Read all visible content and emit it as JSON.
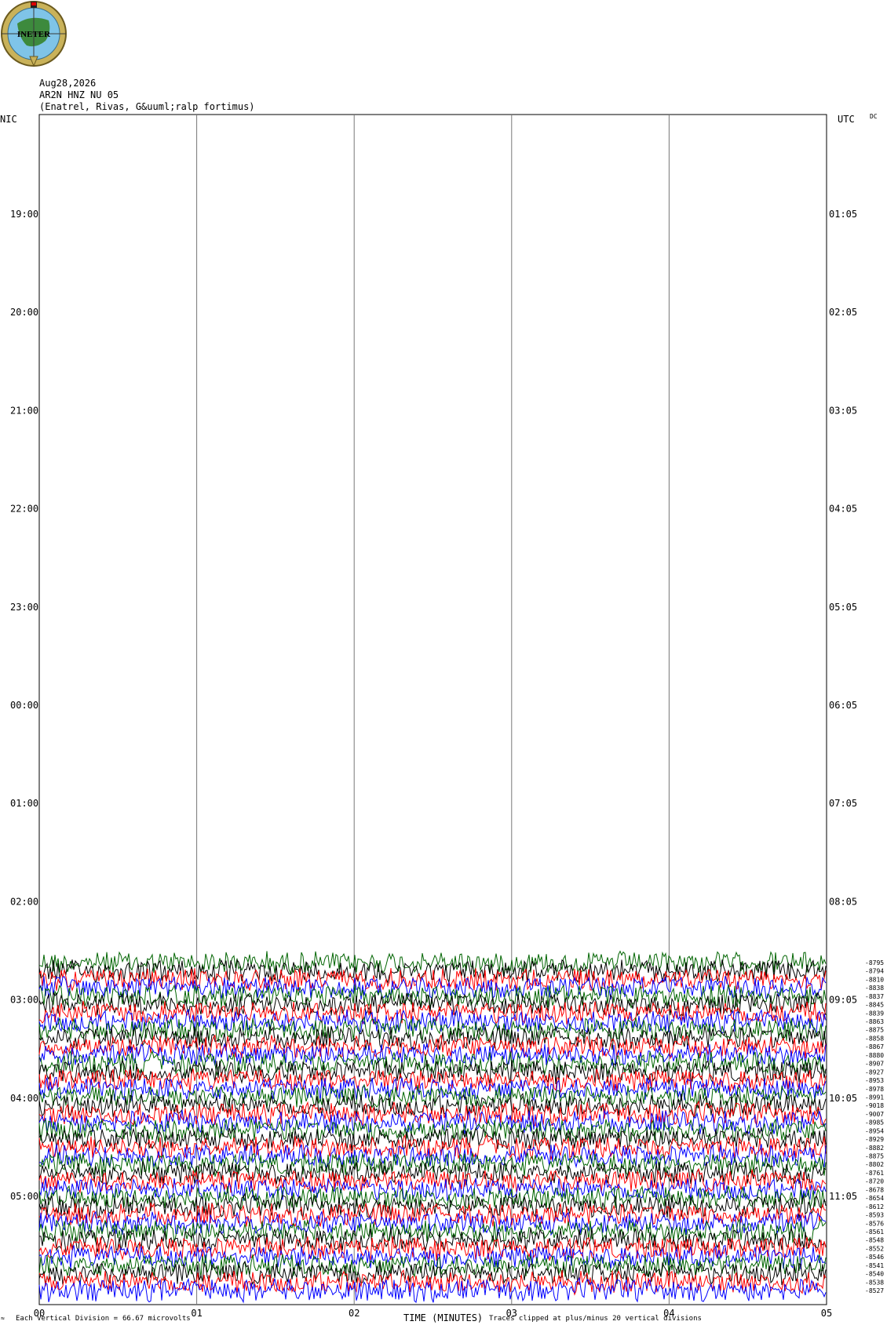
{
  "header": {
    "date": "Aug28,2026",
    "station": "AR2N HNZ NU 05",
    "location": "(Enatrel, Rivas, G&uuml;ralp fortimus)"
  },
  "logo": {
    "text": "INETER",
    "icon": "ineter-globe-logo"
  },
  "axis_corners": {
    "left": "NIC",
    "right": "UTC",
    "right_small": "DC"
  },
  "footer": {
    "left_mark": "≈",
    "vertical_division": "Each Vertical Division =",
    "vertical_value": "66.67 microvolts",
    "xlabel": "TIME (MINUTES)",
    "clip_note": "Traces clipped at plus/minus 20 vertical divisions"
  },
  "colors": {
    "trace_cycle": [
      "#000000",
      "#ff0000",
      "#0000ff",
      "#006400"
    ]
  },
  "chart_data": {
    "type": "line",
    "xlabel": "TIME (MINUTES)",
    "x_ticks": [
      "00",
      "01",
      "02",
      "03",
      "04",
      "05"
    ],
    "xlim": [
      0,
      5
    ],
    "left_time_labels": [
      "19:00",
      "20:00",
      "21:00",
      "22:00",
      "23:00",
      "00:00",
      "01:00",
      "02:00",
      "03:00",
      "04:00",
      "05:00"
    ],
    "right_time_labels": [
      "01:05",
      "02:05",
      "03:05",
      "04:05",
      "05:05",
      "06:05",
      "07:05",
      "08:05",
      "09:05",
      "10:05",
      "11:05"
    ],
    "trace_offsets": [
      "-8795",
      "-8794",
      "-8810",
      "-8838",
      "-8837",
      "-8845",
      "-8839",
      "-8863",
      "-8875",
      "-8858",
      "-8867",
      "-8880",
      "-8907",
      "-8927",
      "-8953",
      "-8978",
      "-8991",
      "-9018",
      "-9007",
      "-8985",
      "-8954",
      "-8929",
      "-8882",
      "-8875",
      "-8802",
      "-8761",
      "-8720",
      "-8678",
      "-8654",
      "-8612",
      "-8593",
      "-8576",
      "-8561",
      "-8548",
      "-8552",
      "-8546",
      "-8541",
      "-8540",
      "-8538",
      "-8527"
    ],
    "grid": true
  }
}
